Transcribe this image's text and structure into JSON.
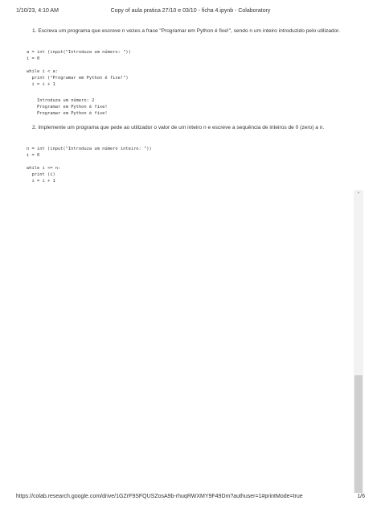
{
  "header": {
    "datetime": "1/10/23, 4:10 AM",
    "title": "Copy of aula pratica 27/10 e 03/10 - ficha 4.ipynb - Colaboratory"
  },
  "exercise1": {
    "instruction": "1. Escreva um programa que escreve n vezes a frase \"Programar em Python é fixe!\", sendo n um inteiro introduzido pelo utilizador.",
    "code": [
      "a = int (input(\"Introduza um número: \"))",
      "i = 0",
      "",
      "while i < a:",
      "  print (\"Programar em Python é fixe!\")",
      "  i = i + 1"
    ],
    "output": [
      "Introduza um número: 2",
      "Programar em Python é fixe!",
      "Programar em Python é fixe!"
    ]
  },
  "exercise2": {
    "instruction": "2. Implemente um programa que pede ao utilizador o valor de um inteiro n e escreve a sequência de inteiros de 0 (zero) a n.",
    "code": [
      "n = int (input(\"Introduza um número inteiro: \"))",
      "i = 0",
      "",
      "while i <= n:",
      "  print (i)",
      "  i = i + 1"
    ]
  },
  "scrollbar": {
    "up_arrow": "˄"
  },
  "footer": {
    "url": "https://colab.research.google.com/drive/1GZrF9SFQUSZosA9b-rhuqRWXMY9F49Dm?authuser=1#printMode=true",
    "page": "1/6"
  }
}
